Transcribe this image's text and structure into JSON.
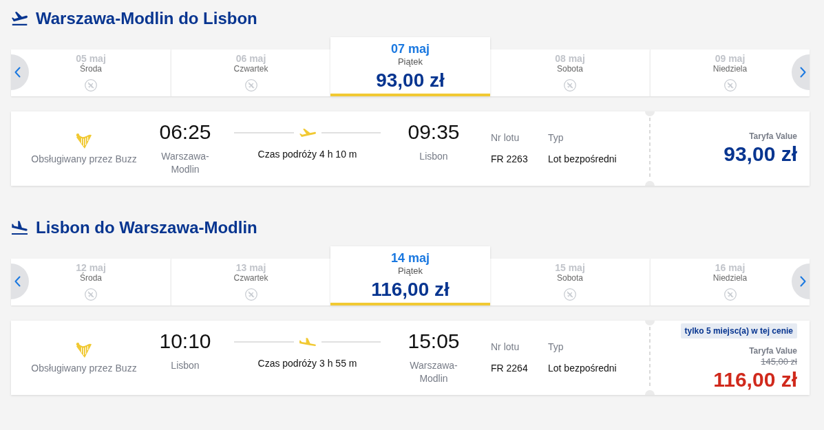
{
  "sections": [
    {
      "kind": "outbound",
      "title": "Warszawa-Modlin do Lisbon",
      "days": [
        {
          "date": "05 maj",
          "weekday": "Środa",
          "selected": false,
          "disabled": true
        },
        {
          "date": "06 maj",
          "weekday": "Czwartek",
          "selected": false,
          "disabled": true
        },
        {
          "date": "07 maj",
          "weekday": "Piątek",
          "price": "93,00 zł",
          "selected": true,
          "disabled": false
        },
        {
          "date": "08 maj",
          "weekday": "Sobota",
          "selected": false,
          "disabled": true
        },
        {
          "date": "09 maj",
          "weekday": "Niedziela",
          "selected": false,
          "disabled": true
        }
      ],
      "flight": {
        "operator": "Obsługiwany przez Buzz",
        "departure_time": "06:25",
        "departure_city": "Warszawa-Modlin",
        "duration": "Czas podróży 4 h 10 m",
        "arrival_time": "09:35",
        "arrival_city": "Lisbon",
        "flight_number_label": "Nr lotu",
        "flight_number": "FR 2263",
        "type_label": "Typ",
        "type": "Lot bezpośredni",
        "fare_name": "Taryfa Value",
        "price": "93,00 zł",
        "discounted": false
      }
    },
    {
      "kind": "return",
      "title": "Lisbon do Warszawa-Modlin",
      "days": [
        {
          "date": "12 maj",
          "weekday": "Środa",
          "selected": false,
          "disabled": true
        },
        {
          "date": "13 maj",
          "weekday": "Czwartek",
          "selected": false,
          "disabled": true
        },
        {
          "date": "14 maj",
          "weekday": "Piątek",
          "price": "116,00 zł",
          "selected": true,
          "disabled": false
        },
        {
          "date": "15 maj",
          "weekday": "Sobota",
          "selected": false,
          "disabled": true
        },
        {
          "date": "16 maj",
          "weekday": "Niedziela",
          "selected": false,
          "disabled": true
        }
      ],
      "flight": {
        "operator": "Obsługiwany przez Buzz",
        "departure_time": "10:10",
        "departure_city": "Lisbon",
        "duration": "Czas podróży 3 h 55 m",
        "arrival_time": "15:05",
        "arrival_city": "Warszawa-Modlin",
        "flight_number_label": "Nr lotu",
        "flight_number": "FR 2264",
        "type_label": "Typ",
        "type": "Lot bezpośredni",
        "seats_badge": "tylko 5 miejsc(a) w tej cenie",
        "fare_name": "Taryfa Value",
        "original_price": "145,00 zł",
        "price": "116,00 zł",
        "discounted": true
      }
    }
  ]
}
